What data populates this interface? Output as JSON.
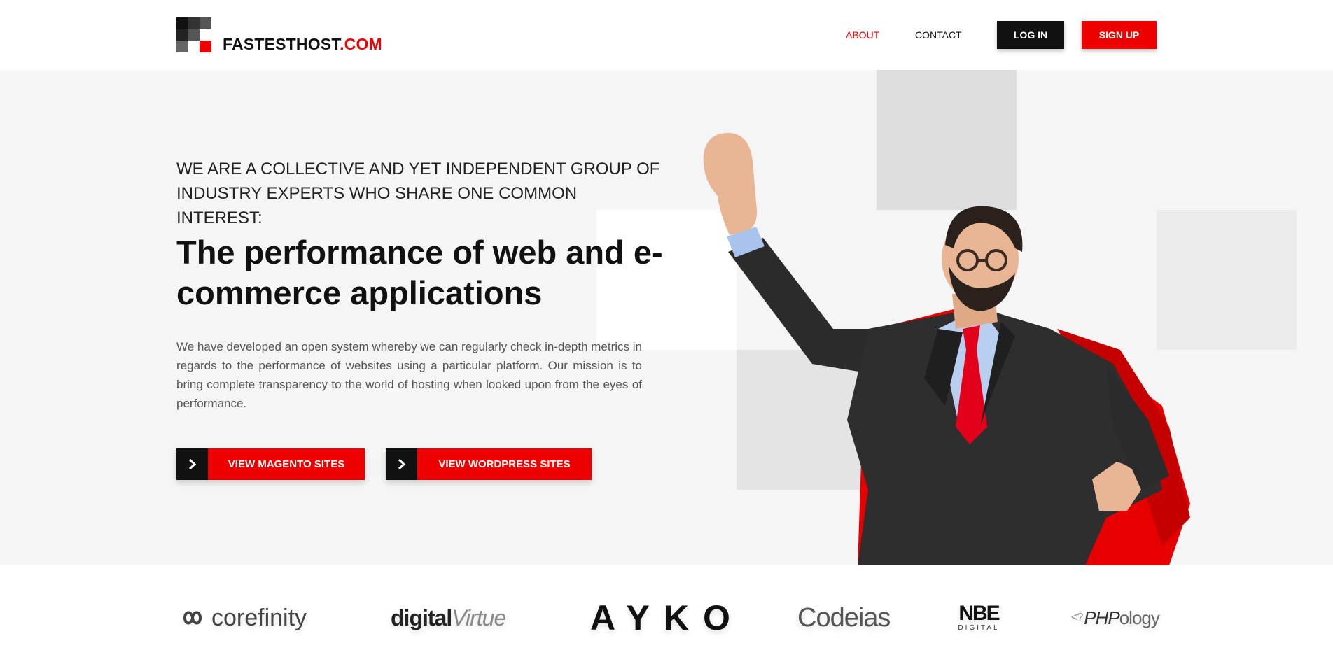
{
  "header": {
    "logo": {
      "text_main": "FASTESTHOST",
      "text_tld": ".COM"
    },
    "nav": {
      "about": "ABOUT",
      "contact": "CONTACT"
    },
    "login_label": "LOG IN",
    "signup_label": "SIGN UP"
  },
  "hero": {
    "eyebrow": "WE ARE A COLLECTIVE AND YET INDEPENDENT GROUP OF INDUSTRY EXPERTS WHO SHARE ONE COMMON INTEREST:",
    "headline": "The performance of web and e-commerce applications",
    "description": "We have developed an open system whereby we can regularly check in-depth metrics in regards to the performance of websites using a particular platform. Our mission is to bring complete transparency to the world of hosting when looked upon from the eyes of performance.",
    "cta_magento": "VIEW MAGENTO SITES",
    "cta_wordpress": "VIEW WORDPRESS SITES"
  },
  "partners": {
    "corefinity": "corefinity",
    "digitalvirtue_a": "digital",
    "digitalvirtue_b": "Virtue",
    "ayko": "AYKO",
    "codeias": "Codeias",
    "nbe_big": "NBE",
    "nbe_small": "DIGITAL",
    "phpology_prefix": "<?",
    "phpology_php": "PHP",
    "phpology_rest": "ology"
  },
  "colors": {
    "accent": "#ee0000",
    "dark": "#111111",
    "hero_bg": "#f5f5f5"
  },
  "icons": {
    "cta_arrow": "chevron-right-icon",
    "hero_image": "superhero-businessman-illustration",
    "logo_mark": "pixel-squares-logo"
  }
}
